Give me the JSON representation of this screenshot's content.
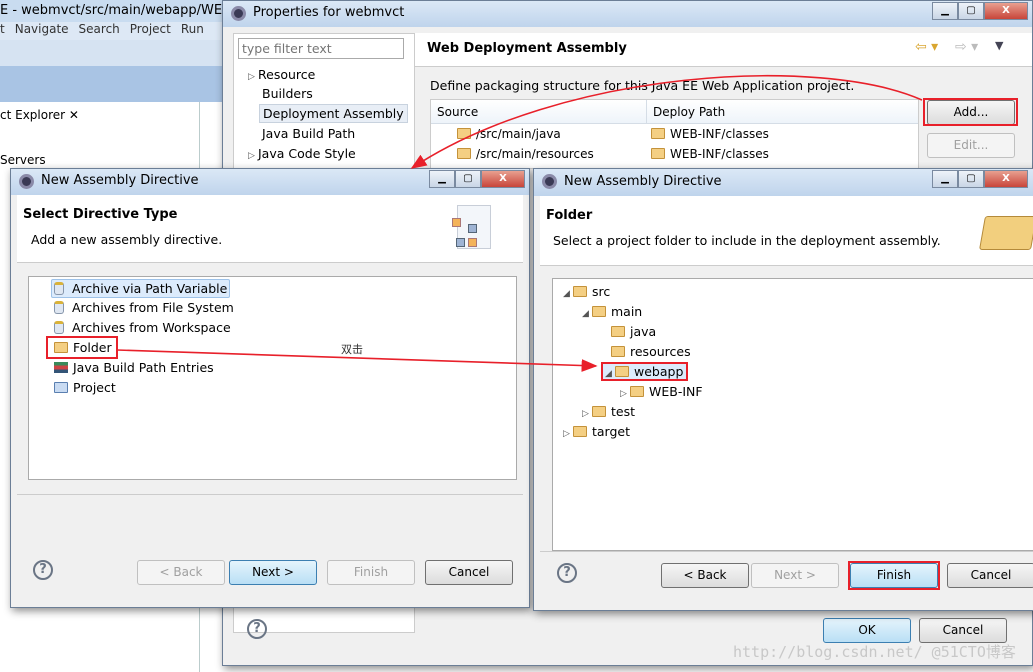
{
  "workbench": {
    "title": "E - webmvct/src/main/webapp/WEB-IN",
    "menu": [
      "t",
      "Navigate",
      "Search",
      "Project",
      "Run"
    ],
    "explorer_tab": "ct Explorer",
    "servers": "Servers"
  },
  "properties": {
    "title": "Properties for webmvct",
    "filter_placeholder": "type filter text",
    "nav": [
      {
        "label": "Resource",
        "expandable": true
      },
      {
        "label": "Builders",
        "expandable": false
      },
      {
        "label": "Deployment Assembly",
        "expandable": false,
        "selected": true
      },
      {
        "label": "Java Build Path",
        "expandable": false
      },
      {
        "label": "Java Code Style",
        "expandable": true
      }
    ],
    "page_title": "Web Deployment Assembly",
    "description": "Define packaging structure for this Java EE Web Application project.",
    "columns": [
      "Source",
      "Deploy Path"
    ],
    "rows": [
      {
        "source": "/src/main/java",
        "deploy": "WEB-INF/classes"
      },
      {
        "source": "/src/main/resources",
        "deploy": "WEB-INF/classes"
      }
    ],
    "add_label": "Add...",
    "edit_label": "Edit...",
    "ok_label": "OK",
    "cancel_label": "Cancel"
  },
  "directive_dialog": {
    "title": "New Assembly Directive",
    "heading": "Select Directive Type",
    "description": "Add a new assembly directive.",
    "items": [
      {
        "label": "Archive via Path Variable",
        "icon": "jar",
        "selected": true
      },
      {
        "label": "Archives from File System",
        "icon": "jar"
      },
      {
        "label": "Archives from Workspace",
        "icon": "jar"
      },
      {
        "label": "Folder",
        "icon": "folder",
        "highlighted": true
      },
      {
        "label": "Java Build Path Entries",
        "icon": "books"
      },
      {
        "label": "Project",
        "icon": "open-folder"
      }
    ],
    "back_label": "< Back",
    "next_label": "Next >",
    "finish_label": "Finish",
    "cancel_label": "Cancel"
  },
  "folder_dialog": {
    "title": "New Assembly Directive",
    "heading": "Folder",
    "description": "Select a project folder to include in the deployment assembly.",
    "tree": [
      {
        "label": "src",
        "level": 0,
        "state": "expanded"
      },
      {
        "label": "main",
        "level": 1,
        "state": "expanded"
      },
      {
        "label": "java",
        "level": 2,
        "state": "leaf"
      },
      {
        "label": "resources",
        "level": 2,
        "state": "leaf"
      },
      {
        "label": "webapp",
        "level": 2,
        "state": "expanded",
        "selected": true
      },
      {
        "label": "WEB-INF",
        "level": 3,
        "state": "collapsed"
      },
      {
        "label": "test",
        "level": 1,
        "state": "collapsed"
      },
      {
        "label": "target",
        "level": 0,
        "state": "collapsed"
      }
    ],
    "back_label": "< Back",
    "next_label": "Next >",
    "finish_label": "Finish",
    "cancel_label": "Cancel"
  },
  "annotation": {
    "double_click": "双击",
    "color": "#e8202a"
  },
  "watermark": "http://blog.csdn.net/ @51CTO博客"
}
